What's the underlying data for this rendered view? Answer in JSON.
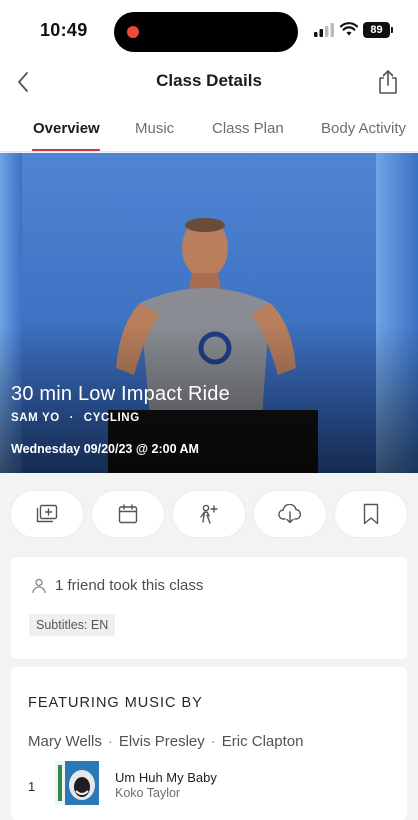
{
  "status_bar": {
    "time": "10:49",
    "battery": "89"
  },
  "nav": {
    "title": "Class Details"
  },
  "tabs": [
    {
      "label": "Overview",
      "active": true
    },
    {
      "label": "Music",
      "active": false
    },
    {
      "label": "Class Plan",
      "active": false
    },
    {
      "label": "Body Activity",
      "active": false
    }
  ],
  "hero": {
    "title": "30 min Low Impact Ride",
    "instructor": "SAM YO",
    "discipline": "CYCLING",
    "meta_separator": "·",
    "date": "Wednesday 09/20/23 @ 2:00 AM"
  },
  "actions": [
    {
      "icon": "add-to-stack-icon"
    },
    {
      "icon": "calendar-icon"
    },
    {
      "icon": "invite-friends-icon"
    },
    {
      "icon": "download-icon"
    },
    {
      "icon": "bookmark-icon"
    }
  ],
  "info": {
    "friends_text": "1 friend took this class",
    "subtitles": "Subtitles: EN"
  },
  "music": {
    "heading": "FEATURING MUSIC BY",
    "artists": [
      "Mary Wells",
      "Elvis Presley",
      "Eric Clapton"
    ],
    "separator": "·",
    "tracks": [
      {
        "number": "1",
        "title": "Um Huh My Baby",
        "artist": "Koko Taylor"
      }
    ]
  },
  "colors": {
    "accent": "#c7364a",
    "background": "#f3f3f4",
    "hero_blue": "#3b6fbf"
  }
}
